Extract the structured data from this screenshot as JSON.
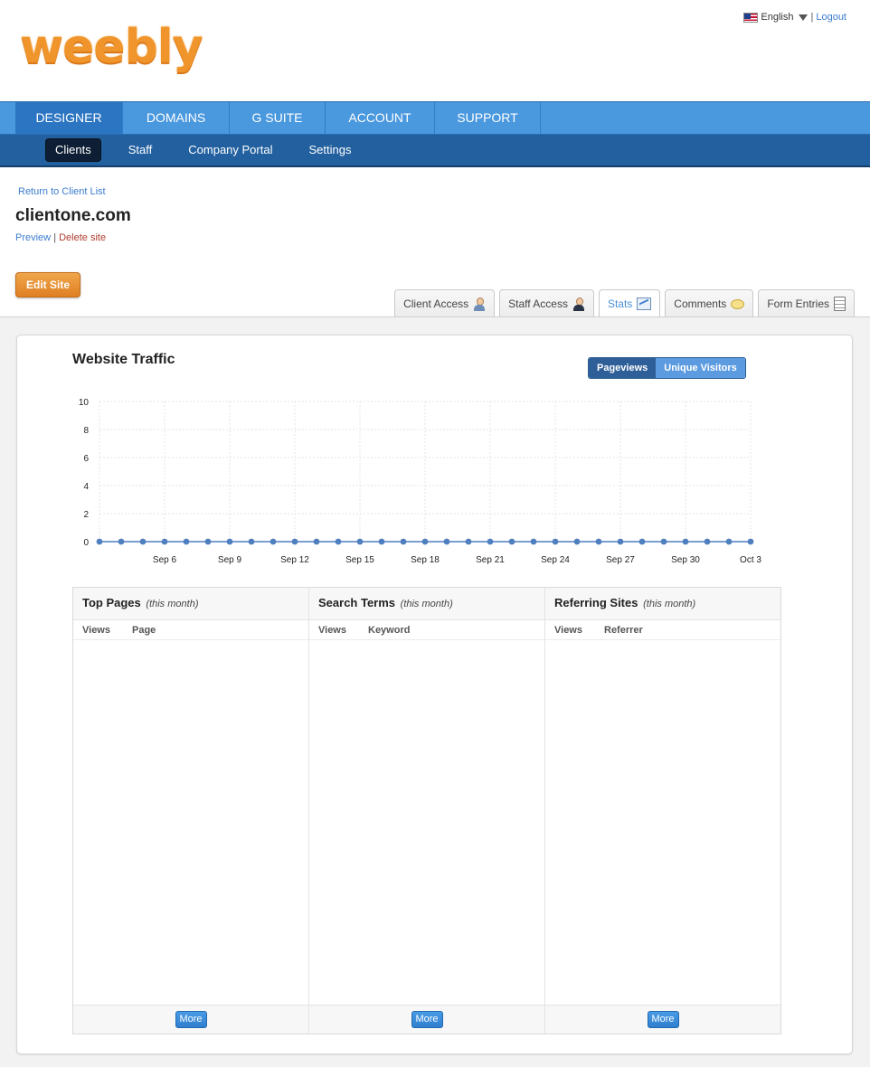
{
  "header": {
    "logo_text": "weebly",
    "language": "English",
    "separator": "|",
    "logout": "Logout"
  },
  "main_nav": [
    {
      "label": "DESIGNER",
      "active": true
    },
    {
      "label": "DOMAINS",
      "active": false
    },
    {
      "label": "G SUITE",
      "active": false
    },
    {
      "label": "ACCOUNT",
      "active": false
    },
    {
      "label": "SUPPORT",
      "active": false
    }
  ],
  "sub_nav": [
    {
      "label": "Clients",
      "active": true
    },
    {
      "label": "Staff",
      "active": false
    },
    {
      "label": "Company Portal",
      "active": false
    },
    {
      "label": "Settings",
      "active": false
    }
  ],
  "site": {
    "return_link": "Return to Client List",
    "title": "clientone.com",
    "preview": "Preview",
    "bar": "|",
    "delete": "Delete site",
    "edit_button": "Edit Site"
  },
  "tabs": [
    {
      "label": "Client Access",
      "icon": "client-person-icon",
      "active": false
    },
    {
      "label": "Staff Access",
      "icon": "staff-person-icon",
      "active": false
    },
    {
      "label": "Stats",
      "icon": "stats-chart-icon",
      "active": true
    },
    {
      "label": "Comments",
      "icon": "comment-bubble-icon",
      "active": false
    },
    {
      "label": "Form Entries",
      "icon": "clipboard-icon",
      "active": false
    }
  ],
  "traffic": {
    "title": "Website Traffic",
    "toggle_on": "Pageviews",
    "toggle_off": "Unique Visitors"
  },
  "chart_data": {
    "type": "line",
    "title": "Website Traffic",
    "xlabel": "",
    "ylabel": "",
    "ylim": [
      0,
      10
    ],
    "y_ticks": [
      "0",
      "2",
      "4",
      "6",
      "8",
      "10"
    ],
    "x_tick_labels": [
      "Sep 6",
      "Sep 9",
      "Sep 12",
      "Sep 15",
      "Sep 18",
      "Sep 21",
      "Sep 24",
      "Sep 27",
      "Sep 30",
      "Oct 3"
    ],
    "x": [
      "Sep 3",
      "Sep 4",
      "Sep 5",
      "Sep 6",
      "Sep 7",
      "Sep 8",
      "Sep 9",
      "Sep 10",
      "Sep 11",
      "Sep 12",
      "Sep 13",
      "Sep 14",
      "Sep 15",
      "Sep 16",
      "Sep 17",
      "Sep 18",
      "Sep 19",
      "Sep 20",
      "Sep 21",
      "Sep 22",
      "Sep 23",
      "Sep 24",
      "Sep 25",
      "Sep 26",
      "Sep 27",
      "Sep 28",
      "Sep 29",
      "Sep 30",
      "Oct 1",
      "Oct 2",
      "Oct 3"
    ],
    "series": [
      {
        "values": [
          0,
          0,
          0,
          0,
          0,
          0,
          0,
          0,
          0,
          0,
          0,
          0,
          0,
          0,
          0,
          0,
          0,
          0,
          0,
          0,
          0,
          0,
          0,
          0,
          0,
          0,
          0,
          0,
          0,
          0,
          0
        ]
      }
    ],
    "grid": true,
    "colors": {
      "line": "#4f7fbf",
      "grid": "#e4e4e4"
    }
  },
  "tables": [
    {
      "title": "Top Pages",
      "period": "(this month)",
      "col1": "Views",
      "col2": "Page",
      "more": "More"
    },
    {
      "title": "Search Terms",
      "period": "(this month)",
      "col1": "Views",
      "col2": "Keyword",
      "more": "More"
    },
    {
      "title": "Referring Sites",
      "period": "(this month)",
      "col1": "Views",
      "col2": "Referrer",
      "more": "More"
    }
  ],
  "colors": {
    "accent_orange": "#f0952b",
    "nav_blue": "#4a98de",
    "subnav_blue": "#22609f",
    "link_blue": "#3b7ccf",
    "delete_red": "#b13b2f"
  }
}
